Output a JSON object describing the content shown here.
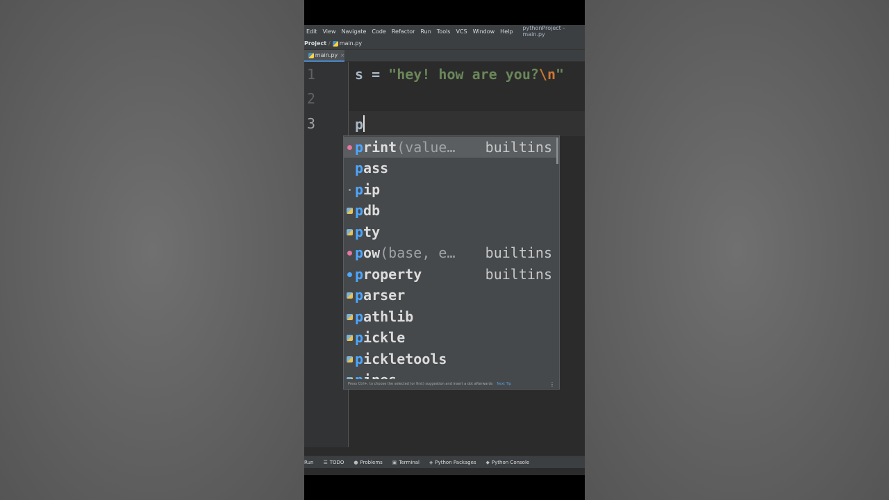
{
  "menu": {
    "items": [
      "Edit",
      "View",
      "Navigate",
      "Code",
      "Refactor",
      "Run",
      "Tools",
      "VCS",
      "Window",
      "Help"
    ],
    "project_title": "pythonProject - main.py"
  },
  "navbar": {
    "project": "Project",
    "file": "main.py"
  },
  "tab": {
    "label": "main.py",
    "close": "×"
  },
  "editor": {
    "line_numbers": [
      "1",
      "2",
      "3"
    ],
    "line1": {
      "var": "s = ",
      "str_open": "\"hey! how are you?",
      "escape": "\\n",
      "str_close": "\""
    },
    "line3": {
      "typed": "p"
    }
  },
  "completion": {
    "items": [
      {
        "match": "p",
        "rest": "rint",
        "sig": "(value…",
        "origin": "builtins",
        "icon": "pink-function-icon"
      },
      {
        "match": "p",
        "rest": "ass",
        "sig": "",
        "origin": "",
        "icon": "none"
      },
      {
        "match": "p",
        "rest": "ip",
        "sig": "",
        "origin": "",
        "icon": "dot-icon"
      },
      {
        "match": "p",
        "rest": "db",
        "sig": "",
        "origin": "",
        "icon": "python-module-icon"
      },
      {
        "match": "p",
        "rest": "ty",
        "sig": "",
        "origin": "",
        "icon": "python-module-icon"
      },
      {
        "match": "p",
        "rest": "ow",
        "sig": "(base, e…",
        "origin": "builtins",
        "icon": "pink-function-icon"
      },
      {
        "match": "p",
        "rest": "roperty",
        "sig": "",
        "origin": "builtins",
        "icon": "blue-class-icon"
      },
      {
        "match": "p",
        "rest": "arser",
        "sig": "",
        "origin": "",
        "icon": "python-module-icon"
      },
      {
        "match": "p",
        "rest": "athlib",
        "sig": "",
        "origin": "",
        "icon": "python-module-icon"
      },
      {
        "match": "p",
        "rest": "ickle",
        "sig": "",
        "origin": "",
        "icon": "python-module-icon"
      },
      {
        "match": "p",
        "rest": "ickletools",
        "sig": "",
        "origin": "",
        "icon": "python-module-icon"
      },
      {
        "match": "p",
        "rest": "ipes",
        "sig": "",
        "origin": "",
        "icon": "python-module-icon"
      }
    ],
    "hint": "Press Ctrl+. to choose the selected (or first) suggestion and insert a dot afterwards",
    "next_tip": "Next Tip",
    "more": "⋮"
  },
  "status_bar": {
    "items": [
      {
        "label": "Run",
        "icon": "run-icon"
      },
      {
        "label": "TODO",
        "icon": "list-icon"
      },
      {
        "label": "Problems",
        "icon": "problems-icon"
      },
      {
        "label": "Terminal",
        "icon": "terminal-icon"
      },
      {
        "label": "Python Packages",
        "icon": "packages-icon"
      },
      {
        "label": "Python Console",
        "icon": "console-icon"
      }
    ]
  }
}
